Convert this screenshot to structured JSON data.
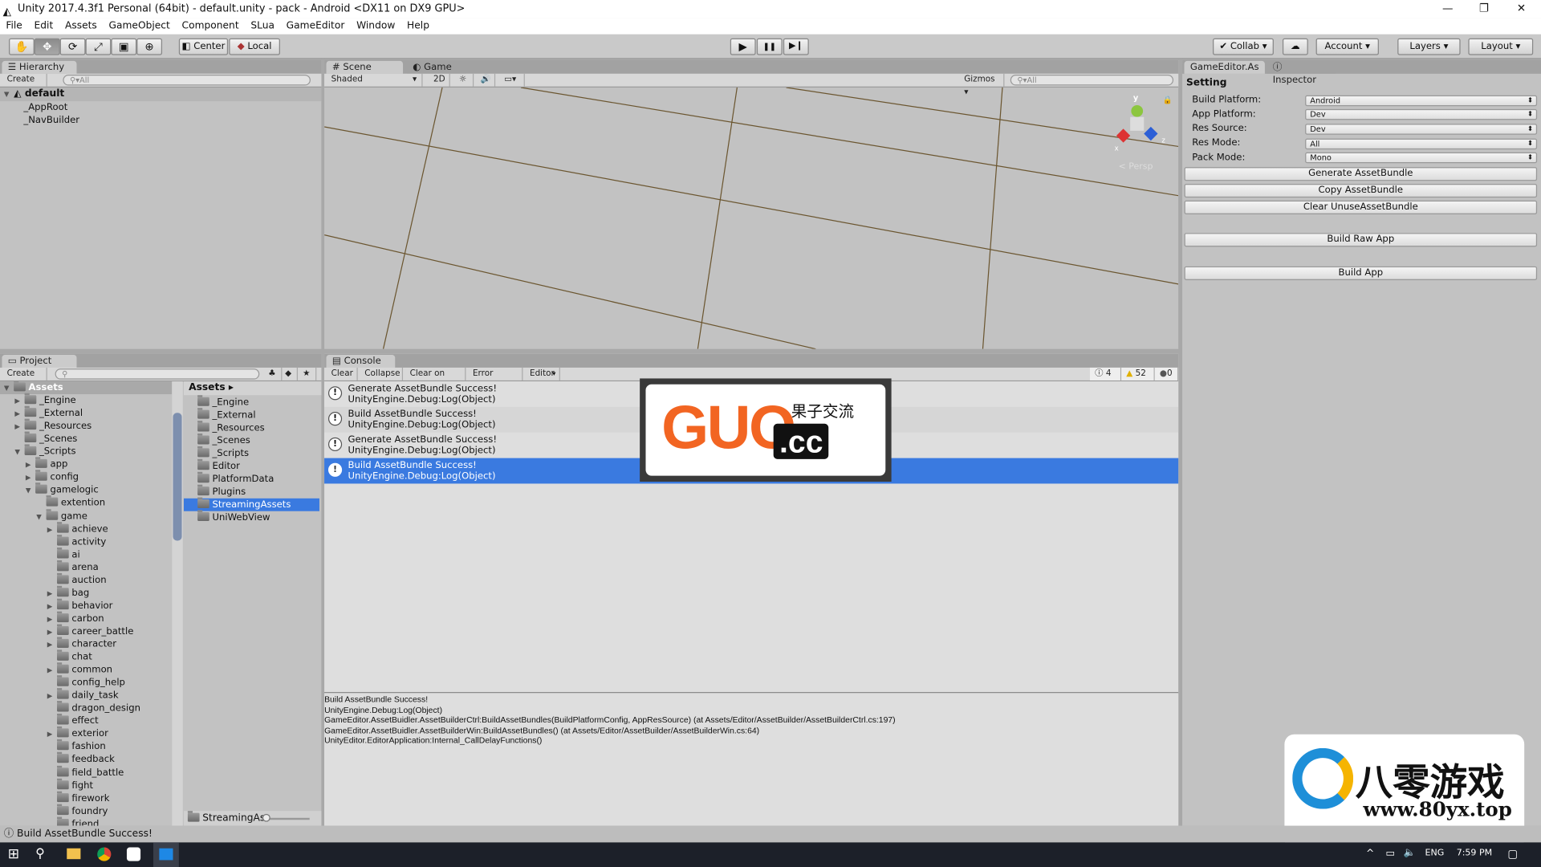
{
  "window": {
    "title": "Unity 2017.4.3f1 Personal (64bit) - default.unity - pack - Android <DX11 on DX9 GPU>",
    "minimize": "—",
    "restore": "❐",
    "close": "✕"
  },
  "menu": [
    "File",
    "Edit",
    "Assets",
    "GameObject",
    "Component",
    "SLua",
    "GameEditor",
    "Window",
    "Help"
  ],
  "toolbar": {
    "tools": [
      "hand-icon",
      "move-icon",
      "rotate-icon",
      "scale-icon",
      "rect-icon",
      "transform-icon"
    ],
    "tool_glyphs": [
      "✋",
      "✥",
      "⟳",
      "⤢",
      "▣",
      "⊕"
    ],
    "active_tool": 1,
    "pivot": "Center",
    "space": "Local",
    "play": "▶",
    "pause": "❚❚",
    "step": "▶❙",
    "collab": "Collab",
    "cloud": "☁",
    "account": "Account",
    "layers": "Layers",
    "layout": "Layout"
  },
  "hierarchy": {
    "tab": "Hierarchy",
    "create": "Create",
    "search_placeholder": "All",
    "scene": "default",
    "items": [
      "_AppRoot",
      "_NavBuilder"
    ]
  },
  "scene": {
    "tabs": [
      "Scene",
      "Game"
    ],
    "shading": "Shaded",
    "mode_2d": "2D",
    "gizmos": "Gizmos",
    "search_placeholder": "All",
    "persp": "Persp",
    "axes": {
      "y": "y",
      "x": "x",
      "z": "z"
    },
    "viewport_color": "#4b3a1d"
  },
  "inspector": {
    "tabs": [
      "GameEditor.As",
      "Inspector"
    ],
    "section": "Setting",
    "fields": [
      {
        "label": "Build Platform:",
        "value": "Android"
      },
      {
        "label": "App Platform:",
        "value": "Dev"
      },
      {
        "label": "Res Source:",
        "value": "Dev"
      },
      {
        "label": "Res Mode:",
        "value": "All"
      },
      {
        "label": "Pack Mode:",
        "value": "Mono"
      }
    ],
    "buttons": [
      "Generate AssetBundle",
      "Copy AssetBundle",
      "Clear UnuseAssetBundle",
      "Build Raw App",
      "Build App"
    ]
  },
  "project": {
    "tab": "Project",
    "create": "Create",
    "breadcrumb": "Assets",
    "footer_path": "StreamingAss",
    "tree": [
      {
        "name": "Assets",
        "level": 0,
        "state": "open"
      },
      {
        "name": "_Engine",
        "level": 1,
        "state": "closed"
      },
      {
        "name": "_External",
        "level": 1,
        "state": "closed"
      },
      {
        "name": "_Resources",
        "level": 1,
        "state": "closed"
      },
      {
        "name": "_Scenes",
        "level": 1,
        "state": "none"
      },
      {
        "name": "_Scripts",
        "level": 1,
        "state": "open"
      },
      {
        "name": "app",
        "level": 2,
        "state": "closed"
      },
      {
        "name": "config",
        "level": 2,
        "state": "closed"
      },
      {
        "name": "gamelogic",
        "level": 2,
        "state": "open"
      },
      {
        "name": "extention",
        "level": 3,
        "state": "none"
      },
      {
        "name": "game",
        "level": 3,
        "state": "open"
      },
      {
        "name": "achieve",
        "level": 4,
        "state": "closed"
      },
      {
        "name": "activity",
        "level": 4,
        "state": "none"
      },
      {
        "name": "ai",
        "level": 4,
        "state": "none"
      },
      {
        "name": "arena",
        "level": 4,
        "state": "none"
      },
      {
        "name": "auction",
        "level": 4,
        "state": "none"
      },
      {
        "name": "bag",
        "level": 4,
        "state": "closed"
      },
      {
        "name": "behavior",
        "level": 4,
        "state": "closed"
      },
      {
        "name": "carbon",
        "level": 4,
        "state": "closed"
      },
      {
        "name": "career_battle",
        "level": 4,
        "state": "closed"
      },
      {
        "name": "character",
        "level": 4,
        "state": "closed"
      },
      {
        "name": "chat",
        "level": 4,
        "state": "none"
      },
      {
        "name": "common",
        "level": 4,
        "state": "closed"
      },
      {
        "name": "config_help",
        "level": 4,
        "state": "none"
      },
      {
        "name": "daily_task",
        "level": 4,
        "state": "closed"
      },
      {
        "name": "dragon_design",
        "level": 4,
        "state": "none"
      },
      {
        "name": "effect",
        "level": 4,
        "state": "none"
      },
      {
        "name": "exterior",
        "level": 4,
        "state": "closed"
      },
      {
        "name": "fashion",
        "level": 4,
        "state": "none"
      },
      {
        "name": "feedback",
        "level": 4,
        "state": "none"
      },
      {
        "name": "field_battle",
        "level": 4,
        "state": "none"
      },
      {
        "name": "fight",
        "level": 4,
        "state": "none"
      },
      {
        "name": "firework",
        "level": 4,
        "state": "none"
      },
      {
        "name": "foundry",
        "level": 4,
        "state": "none"
      },
      {
        "name": "friend",
        "level": 4,
        "state": "none"
      }
    ],
    "folders": [
      "_Engine",
      "_External",
      "_Resources",
      "_Scenes",
      "_Scripts",
      "Editor",
      "PlatformData",
      "Plugins",
      "StreamingAssets",
      "UniWebView"
    ],
    "selected_folder": "StreamingAssets"
  },
  "console": {
    "tab": "Console",
    "buttons": [
      "Clear",
      "Collapse",
      "Clear on Play",
      "Error Pause",
      "Editor"
    ],
    "counts": {
      "info": "4",
      "warn": "52",
      "error": "0"
    },
    "entries": [
      {
        "line1": "Generate AssetBundle Success!",
        "line2": "UnityEngine.Debug:Log(Object)"
      },
      {
        "line1": "Build AssetBundle Success!",
        "line2": "UnityEngine.Debug:Log(Object)"
      },
      {
        "line1": "Generate AssetBundle Success!",
        "line2": "UnityEngine.Debug:Log(Object)"
      },
      {
        "line1": "Build AssetBundle Success!",
        "line2": "UnityEngine.Debug:Log(Object)"
      }
    ],
    "selected": 3,
    "detail": [
      "Build AssetBundle Success!",
      "UnityEngine.Debug:Log(Object)",
      "GameEditor.AssetBuidler.AssetBuilderCtrl:BuildAssetBundles(BuildPlatformConfig, AppResSource) (at Assets/Editor/AssetBuilder/AssetBuilderCtrl.cs:197)",
      "GameEditor.AssetBuidler.AssetBuilderWin:BuildAssetBundles() (at Assets/Editor/AssetBuilder/AssetBuilderWin.cs:64)",
      "UnityEditor.EditorApplication:Internal_CallDelayFunctions()"
    ]
  },
  "status": {
    "message": "Build AssetBundle Success!"
  },
  "watermarks": {
    "guo": {
      "main": "GUO",
      "suffix": ".cc",
      "cn": "果子交流"
    },
    "yx": {
      "cn": "八零游戏",
      "url": "www.80yx.top"
    }
  },
  "taskbar": {
    "lang": "ENG",
    "time": "7:59 PM"
  }
}
